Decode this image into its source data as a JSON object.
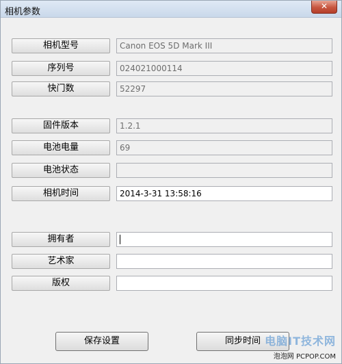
{
  "window": {
    "title": "相机参数",
    "close_label": "✕"
  },
  "rows": [
    {
      "label": "相机型号",
      "value": "Canon EOS 5D Mark III",
      "editable": false
    },
    {
      "label": "序列号",
      "value": "024021000114",
      "editable": false
    },
    {
      "label": "快门数",
      "value": "52297",
      "editable": false
    },
    {
      "label": "固件版本",
      "value": "1.2.1",
      "editable": false
    },
    {
      "label": "电池电量",
      "value": "69",
      "editable": false
    },
    {
      "label": "电池状态",
      "value": "",
      "editable": false
    },
    {
      "label": "相机时间",
      "value": "2014-3-31 13:58:16",
      "editable": true
    },
    {
      "label": "拥有者",
      "value": "",
      "editable": true
    },
    {
      "label": "艺术家",
      "value": "",
      "editable": true
    },
    {
      "label": "版权",
      "value": "",
      "editable": true
    }
  ],
  "buttons": {
    "save": "保存设置",
    "sync_time": "同步时间"
  },
  "watermark": {
    "brand": "电脑IT技术网",
    "site": "泡泡网 PCPOP.COM"
  }
}
